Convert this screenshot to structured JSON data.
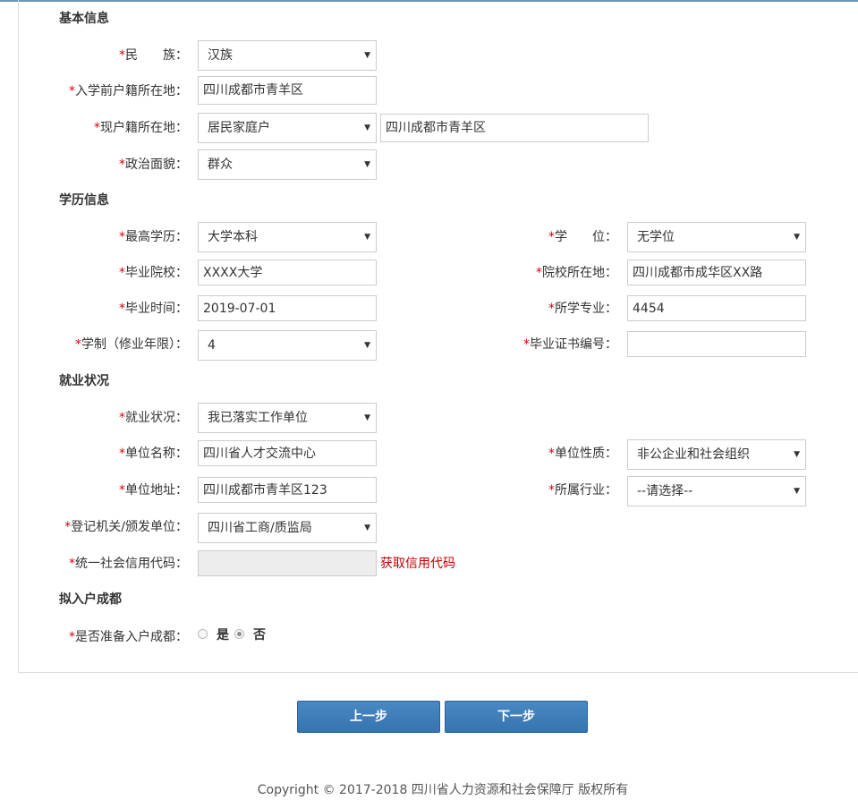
{
  "sections": {
    "basic": "基本信息",
    "education": "学历信息",
    "employment": "就业状况",
    "settle": "拟入户成都"
  },
  "basic": {
    "ethnicity_label": "民　　族：",
    "ethnicity_value": "汉族",
    "pre_household_label": "入学前户籍所在地：",
    "pre_household_value": "四川成都市青羊区",
    "current_household_label": "现户籍所在地：",
    "current_household_type": "居民家庭户",
    "current_household_addr": "四川成都市青羊区",
    "political_label": "政治面貌：",
    "political_value": "群众"
  },
  "education": {
    "degree_level_label": "最高学历：",
    "degree_level_value": "大学本科",
    "degree_label": "学　　位：",
    "degree_value": "无学位",
    "school_label": "毕业院校：",
    "school_value": "XXXX大学",
    "school_location_label": "院校所在地：",
    "school_location_value": "四川成都市成华区XX路",
    "grad_date_label": "毕业时间：",
    "grad_date_value": "2019-07-01",
    "major_label": "所学专业：",
    "major_value": "4454",
    "years_label": "学制（修业年限）：",
    "years_value": "4",
    "cert_no_label": "毕业证书编号：",
    "cert_no_value": ""
  },
  "employment": {
    "status_label": "就业状况：",
    "status_value": "我已落实工作单位",
    "org_name_label": "单位名称：",
    "org_name_value": "四川省人才交流中心",
    "org_type_label": "单位性质：",
    "org_type_value": "非公企业和社会组织",
    "org_addr_label": "单位地址：",
    "org_addr_value": "四川成都市青羊区123",
    "industry_label": "所属行业：",
    "industry_value": "--请选择--",
    "registry_label": "登记机关/颁发单位：",
    "registry_value": "四川省工商/质监局",
    "credit_code_label": "统一社会信用代码：",
    "credit_code_value": "",
    "credit_code_link": "获取信用代码"
  },
  "settle": {
    "question_label": "是否准备入户成都：",
    "yes": "是",
    "no": "否",
    "selected": "no"
  },
  "required_mark": "*",
  "buttons": {
    "prev": "上一步",
    "next": "下一步"
  },
  "footer": "Copyright © 2017-2018 四川省人力资源和社会保障厅 版权所有",
  "colors": {
    "required": "#d9000f",
    "link": "#c00000",
    "button": "#3a78b5"
  }
}
